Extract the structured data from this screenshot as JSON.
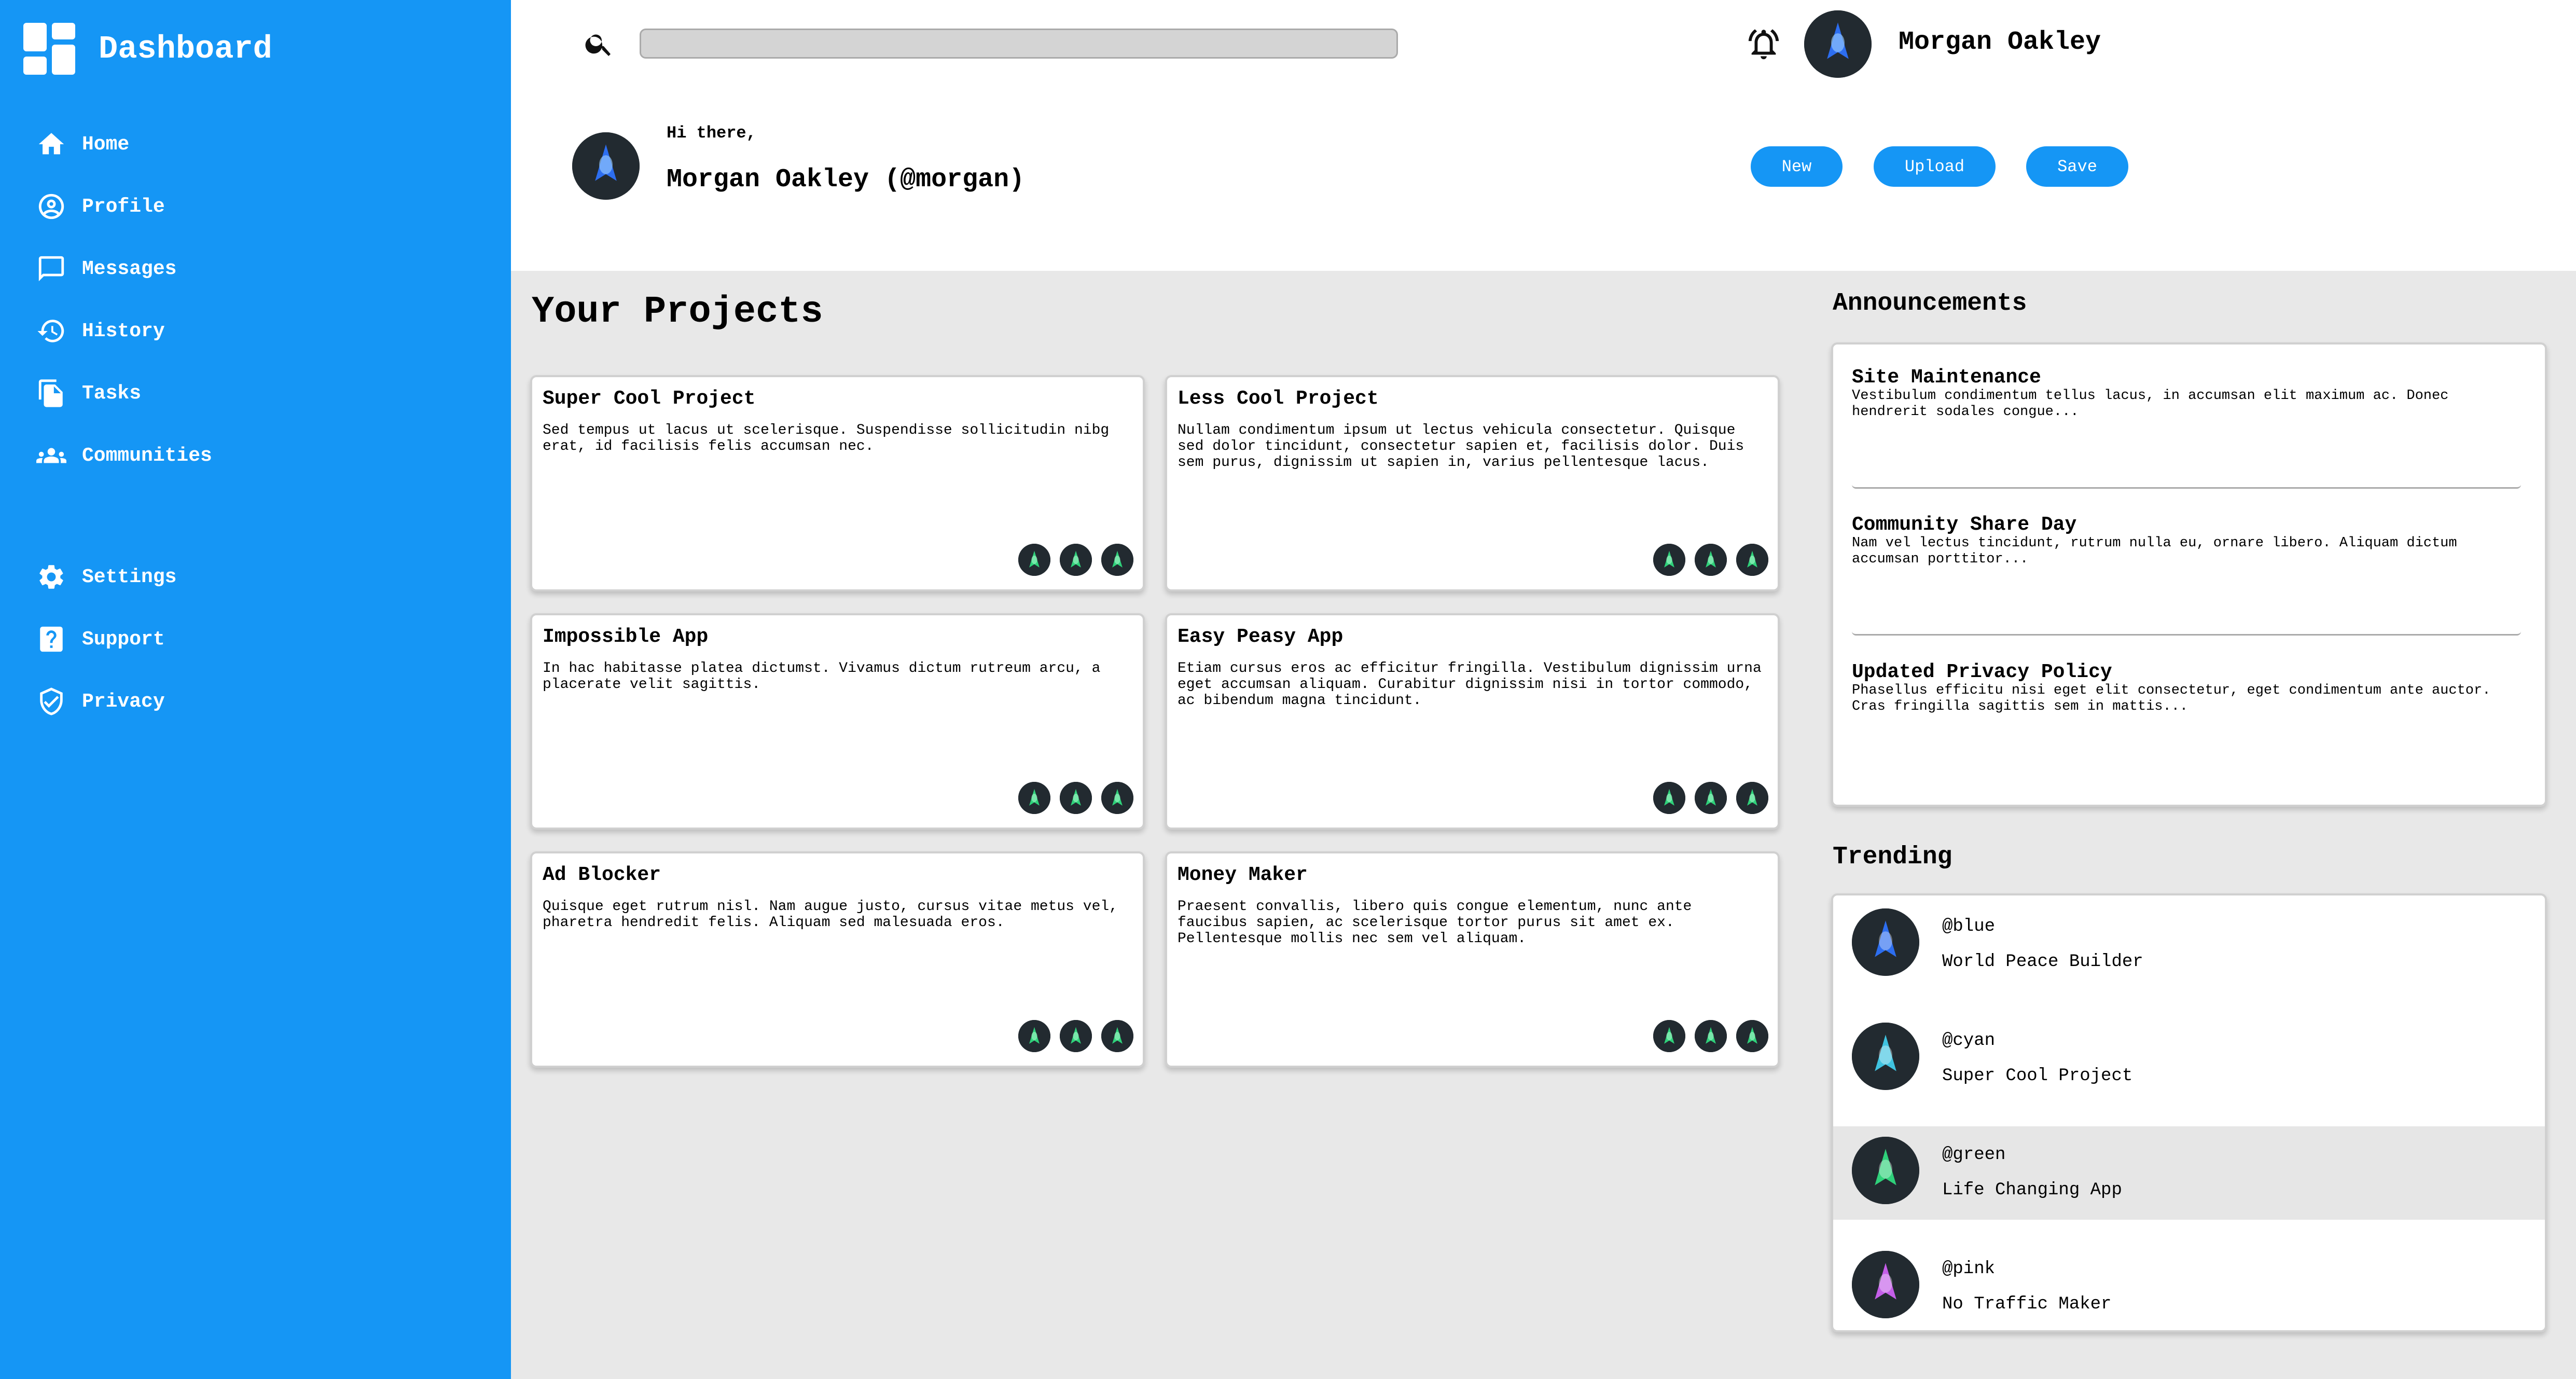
{
  "sidebar": {
    "brand": "Dashboard",
    "items": [
      {
        "label": "Home",
        "icon": "home-icon"
      },
      {
        "label": "Profile",
        "icon": "profile-icon"
      },
      {
        "label": "Messages",
        "icon": "message-icon"
      },
      {
        "label": "History",
        "icon": "history-icon"
      },
      {
        "label": "Tasks",
        "icon": "tasks-icon"
      },
      {
        "label": "Communities",
        "icon": "communities-icon"
      }
    ],
    "bottom_items": [
      {
        "label": "Settings",
        "icon": "gear-icon"
      },
      {
        "label": "Support",
        "icon": "help-icon"
      },
      {
        "label": "Privacy",
        "icon": "shield-icon"
      }
    ]
  },
  "header": {
    "search": {
      "placeholder": "",
      "value": ""
    },
    "user_name": "Morgan Oakley",
    "greeting_small": "Hi there,",
    "greeting_big": "Morgan Oakley (@morgan)",
    "buttons": {
      "new": "New",
      "upload": "Upload",
      "save": "Save"
    }
  },
  "projects": {
    "title": "Your Projects",
    "cards": [
      {
        "title": "Super Cool Project",
        "desc": "Sed tempus ut lacus ut scelerisque. Suspendisse sollicitudin nibg erat, id facilisis felis accumsan nec."
      },
      {
        "title": "Less Cool Project",
        "desc": "Nullam condimentum ipsum ut lectus vehicula consectetur. Quisque sed dolor tincidunt, consectetur sapien et, facilisis dolor. Duis sem purus, dignissim ut sapien in, varius pellentesque lacus."
      },
      {
        "title": "Impossible App",
        "desc": "In hac habitasse platea dictumst. Vivamus dictum rutreum arcu, a placerate velit sagittis."
      },
      {
        "title": "Easy Peasy App",
        "desc": "Etiam cursus eros ac efficitur fringilla. Vestibulum dignissim urna eget accumsan aliquam. Curabitur dignissim nisi in tortor commodo, ac bibendum magna tincidunt."
      },
      {
        "title": "Ad Blocker",
        "desc": "Quisque eget rutrum nisl. Nam augue justo, cursus vitae metus vel, pharetra hendredit felis. Aliquam sed malesuada eros."
      },
      {
        "title": "Money Maker",
        "desc": "Praesent convallis, libero quis congue elementum, nunc ante faucibus sapien, ac scelerisque tortor purus sit amet ex. Pellentesque mollis nec sem vel aliquam."
      }
    ]
  },
  "announcements": {
    "title": "Announcements",
    "items": [
      {
        "title": "Site Maintenance",
        "text": "Vestibulum condimentum tellus lacus, in accumsan elit maximum ac. Donec hendrerit sodales congue..."
      },
      {
        "title": "Community Share Day",
        "text": "Nam vel lectus tincidunt, rutrum nulla eu, ornare libero. Aliquam dictum accumsan porttitor..."
      },
      {
        "title": "Updated Privacy Policy",
        "text": "Phasellus efficitu nisi eget elit consectetur, eget condimentum ante auctor. Cras fringilla sagittis sem in mattis..."
      }
    ]
  },
  "trending": {
    "title": "Trending",
    "items": [
      {
        "handle": "@blue",
        "project": "World Peace Builder",
        "color": "#2d6ef0"
      },
      {
        "handle": "@cyan",
        "project": "Super Cool Project",
        "color": "#3fc3e0"
      },
      {
        "handle": "@green",
        "project": "Life Changing App",
        "color": "#2fd17a"
      },
      {
        "handle": "@pink",
        "project": "No Traffic Maker",
        "color": "#c45ee8"
      }
    ]
  },
  "colors": {
    "accent": "#1596f5",
    "background": "#e8e8e8",
    "card_border": "#d0d0d0",
    "avatar_bg": "#222a30",
    "user_avatar": "#2d6ef0",
    "project_avatar": "#2fd17a"
  }
}
